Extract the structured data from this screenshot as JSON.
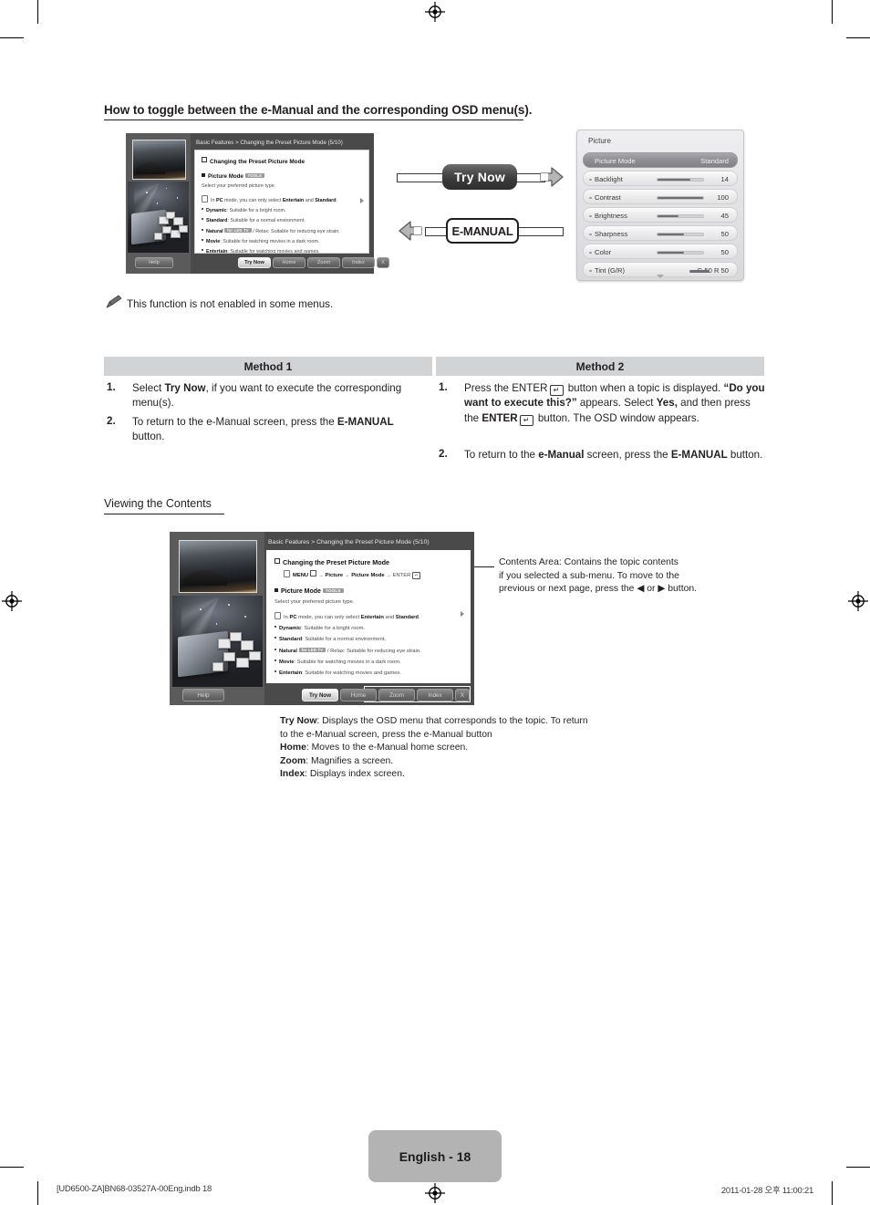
{
  "document": {
    "heading": "How to toggle between the e-Manual and the corresponding OSD menu(s).",
    "section_heading": "Viewing the Contents",
    "note": "This function is not enabled in some menus.",
    "page_label": "English - 18",
    "footer_left": "[UD6500-ZA]BN68-03527A-00Eng.indb   18",
    "footer_right": "2011-01-28   오후 11:00:21"
  },
  "toggle_graphic": {
    "try_now_label": "Try Now",
    "emanual_label": "E-MANUAL"
  },
  "emanual_screen": {
    "breadcrumb": "Basic Features > Changing the Preset Picture Mode (5/10)",
    "topic_title": "Changing the Preset Picture Mode",
    "menu_path": "MENU → Picture → Picture Mode → ENTER",
    "subheading": "Picture Mode",
    "subheading_badge": "TOOLS",
    "subheading_desc": "Select your preferred picture type.",
    "pc_note_lead": "In ",
    "pc_note_bold1": "PC",
    "pc_note_mid": " mode, you can only select ",
    "pc_note_bold2": "Entertain",
    "pc_note_and": " and ",
    "pc_note_bold3": "Standard",
    "pc_note_end": ".",
    "bullets": [
      {
        "term": "Dynamic",
        "desc": ": Suitable for a bright room.",
        "badge": ""
      },
      {
        "term": "Standard",
        "desc": ": Suitable for a normal environment.",
        "badge": ""
      },
      {
        "term": "Natural",
        "desc": " / Relax: Suitable for reducing eye strain.",
        "badge": "for LED TV"
      },
      {
        "term": "Movie",
        "desc": ": Suitable for watching movies in a dark room.",
        "badge": ""
      },
      {
        "term": "Entertain",
        "desc": ": Suitable for watching movies and games.",
        "badge": ""
      }
    ],
    "help_label": "Help",
    "buttons": [
      "Try Now",
      "Home",
      "Zoom",
      "Index"
    ],
    "close_label": "X"
  },
  "osd": {
    "title": "Picture",
    "rows": [
      {
        "label": "Picture Mode",
        "value": "Standard",
        "type": "select",
        "selected": true
      },
      {
        "label": "Backlight",
        "value": "14",
        "type": "slider",
        "fill": 72,
        "selected": false
      },
      {
        "label": "Contrast",
        "value": "100",
        "type": "slider",
        "fill": 100,
        "selected": false
      },
      {
        "label": "Brightness",
        "value": "45",
        "type": "slider",
        "fill": 45,
        "selected": false
      },
      {
        "label": "Sharpness",
        "value": "50",
        "type": "slider",
        "fill": 58,
        "selected": false
      },
      {
        "label": "Color",
        "value": "50",
        "type": "slider",
        "fill": 58,
        "selected": false
      },
      {
        "label": "Tint (G/R)",
        "value": "G 50          R 50",
        "type": "tint",
        "selected": false
      }
    ]
  },
  "methods": {
    "method1": {
      "header": "Method 1",
      "steps": [
        {
          "num": "1.",
          "parts": [
            {
              "t": "Select ",
              "b": false
            },
            {
              "t": "Try Now",
              "b": true
            },
            {
              "t": ", if you want to execute the corresponding menu(s).",
              "b": false
            }
          ]
        },
        {
          "num": "2.",
          "parts": [
            {
              "t": "To return to the e-Manual screen, press the ",
              "b": false
            },
            {
              "t": "E-MANUAL",
              "b": true
            },
            {
              "t": " button.",
              "b": false
            }
          ]
        }
      ]
    },
    "method2": {
      "header": "Method 2",
      "steps": [
        {
          "num": "1.",
          "parts": [
            {
              "t": "Press the ENTER",
              "b": false
            },
            {
              "t": " ",
              "b": false
            },
            {
              "t": " button when a topic is displayed. ",
              "b": false
            },
            {
              "t": "“Do you want to execute this?”",
              "b": true
            },
            {
              "t": " appears. Select ",
              "b": false
            },
            {
              "t": "Yes,",
              "b": true
            },
            {
              "t": " and then press the ",
              "b": false
            },
            {
              "t": "ENTER",
              "b": true
            },
            {
              "t": " button. The OSD window appears.",
              "b": false
            }
          ]
        },
        {
          "num": "2.",
          "parts": [
            {
              "t": "To return to the ",
              "b": false
            },
            {
              "t": "e-Manual",
              "b": true
            },
            {
              "t": " screen, press the ",
              "b": false
            },
            {
              "t": "E-MANUAL",
              "b": true
            },
            {
              "t": " button.",
              "b": false
            }
          ]
        }
      ]
    }
  },
  "contents_callout": {
    "line1": "Contents Area: Contains the topic contents",
    "line2": "if you selected a sub-menu. To move to the",
    "line3_a": "previous or next page, press the ",
    "line3_b": " or ",
    "line3_c": " button."
  },
  "button_legend": [
    {
      "term": "Try Now",
      "desc": ": Displays the OSD menu that corresponds to the topic. To return"
    },
    {
      "term": "",
      "desc": "to the e-Manual screen, press the e-Manual button"
    },
    {
      "term": "Home",
      "desc": ": Moves to the e-Manual home screen."
    },
    {
      "term": "Zoom",
      "desc": ": Magnifies a screen."
    },
    {
      "term": "Index",
      "desc": ": Displays index screen."
    }
  ],
  "colors": {
    "ink": "#231f20",
    "table_header_bg": "#d2d3d5",
    "page_box_bg": "#b3b3b3",
    "tv_bezel": "#4a4a4a"
  }
}
